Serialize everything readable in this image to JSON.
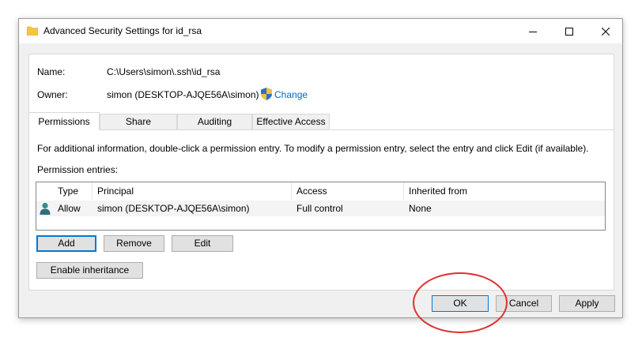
{
  "window": {
    "title": "Advanced Security Settings for id_rsa",
    "controls": [
      "minimize",
      "maximize",
      "close"
    ]
  },
  "info": {
    "name_label": "Name:",
    "name_value": "C:\\Users\\simon\\.ssh\\id_rsa",
    "owner_label": "Owner:",
    "owner_value": "simon (DESKTOP-AJQE56A\\simon)",
    "change_link": "Change"
  },
  "tabs": [
    {
      "label": "Permissions",
      "active": true
    },
    {
      "label": "Share",
      "active": false
    },
    {
      "label": "Auditing",
      "active": false
    },
    {
      "label": "Effective Access",
      "active": false
    }
  ],
  "description": "For additional information, double-click a permission entry. To modify a permission entry, select the entry and click Edit (if available).",
  "entries_label": "Permission entries:",
  "table": {
    "columns": [
      "Type",
      "Principal",
      "Access",
      "Inherited from"
    ],
    "rows": [
      {
        "type": "Allow",
        "principal": "simon (DESKTOP-AJQE56A\\simon)",
        "access": "Full control",
        "inherited": "None"
      }
    ]
  },
  "buttons": {
    "add": "Add",
    "remove": "Remove",
    "edit": "Edit",
    "enable_inheritance": "Enable inheritance",
    "ok": "OK",
    "cancel": "Cancel",
    "apply": "Apply"
  },
  "colors": {
    "link": "#0066cc",
    "focus": "#0078d7",
    "annotation": "#e03030"
  }
}
